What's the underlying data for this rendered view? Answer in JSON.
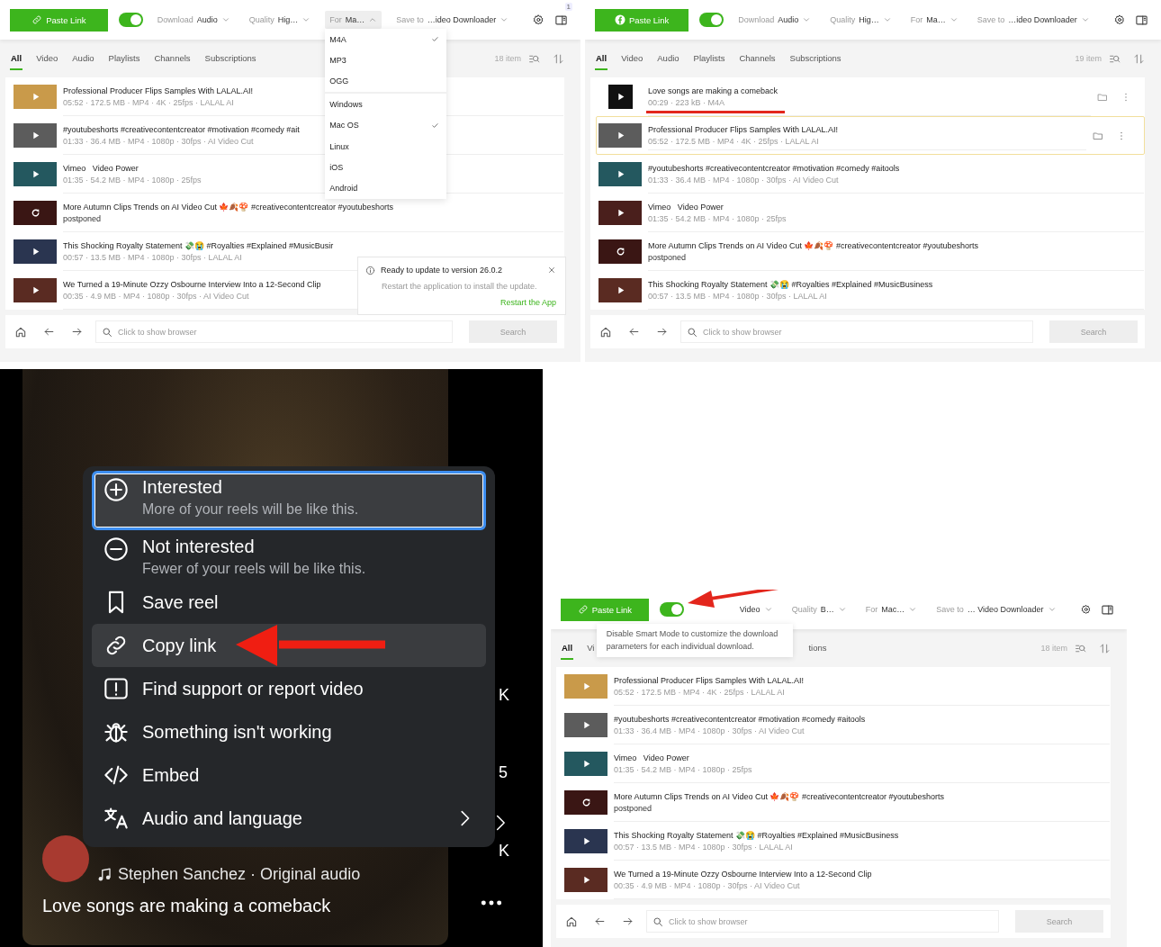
{
  "panels": [
    {
      "kind": "downloader",
      "toolbar": {
        "paste_button": {
          "label": "Paste Link",
          "kind": "link"
        },
        "smart_mode_on": true,
        "badge": "1",
        "selects": [
          {
            "label": "Download",
            "value": "Audio",
            "open": false
          },
          {
            "label": "Quality",
            "value": "Hig…",
            "open": false
          },
          {
            "label": "For",
            "value": "Ma…",
            "open": true
          },
          {
            "label": "Save to",
            "value": "…ideo Downloader",
            "open": false
          }
        ]
      },
      "dropdown": {
        "groups": [
          [
            {
              "label": "M4A",
              "checked": true
            },
            {
              "label": "MP3",
              "checked": false
            },
            {
              "label": "OGG",
              "checked": false
            }
          ],
          [
            {
              "label": "Windows",
              "checked": false
            },
            {
              "label": "Mac OS",
              "checked": true
            },
            {
              "label": "Linux",
              "checked": false
            },
            {
              "label": "iOS",
              "checked": false
            },
            {
              "label": "Android",
              "checked": false
            }
          ]
        ]
      },
      "tabs": [
        {
          "label": "All",
          "selected": true
        },
        {
          "label": "Video",
          "selected": false
        },
        {
          "label": "Audio",
          "selected": false
        },
        {
          "label": "Playlists",
          "selected": false
        },
        {
          "label": "Channels",
          "selected": false
        },
        {
          "label": "Subscriptions",
          "selected": false
        }
      ],
      "item_count": "18 item",
      "rows": [
        {
          "kind": "video",
          "title": "Professional Producer Flips Samples With LALAL.AI!",
          "meta": "05:52 · 172.5 MB · MP4 · 4K · 25fps · LALAL AI"
        },
        {
          "kind": "video",
          "title": "#youtubeshorts #creativecontentcreator #motivation #comedy #ait",
          "meta": "01:33 · 36.4 MB · MP4 · 1080p · 30fps · AI Video Cut"
        },
        {
          "kind": "video",
          "title": "Vimeo   Video Power",
          "meta": "01:35 · 54.2 MB · MP4 · 1080p · 25fps"
        },
        {
          "kind": "reload",
          "title": "More Autumn Clips Trends on AI Video Cut 🍁🍂🍄 #creativecontentcreator #youtubeshorts",
          "status": "postponed"
        },
        {
          "kind": "video",
          "title": "This Shocking Royalty Statement 💸😭 #Royalties #Explained #MusicBusir",
          "meta": "00:57 · 13.5 MB · MP4 · 1080p · 30fps · LALAL AI"
        },
        {
          "kind": "video",
          "title": "We Turned a 19-Minute Ozzy Osbourne Interview Into a 12-Second Clip",
          "meta": "00:35 · 4.9 MB · MP4 · 1080p · 30fps · AI Video Cut"
        }
      ],
      "browser": {
        "placeholder": "Click to show browser",
        "search": "Search"
      },
      "notification": {
        "title": "Ready to update to version 26.0.2",
        "body": "Restart the application to install the update.",
        "action": "Restart the App"
      }
    },
    {
      "kind": "downloader",
      "toolbar": {
        "paste_button": {
          "label": "Paste Link",
          "kind": "facebook"
        },
        "smart_mode_on": true,
        "selects": [
          {
            "label": "Download",
            "value": "Audio",
            "open": false
          },
          {
            "label": "Quality",
            "value": "Hig…",
            "open": false
          },
          {
            "label": "For",
            "value": "Ma…",
            "open": false
          },
          {
            "label": "Save to",
            "value": "…ideo Downloader",
            "open": false
          }
        ]
      },
      "tabs": [
        {
          "label": "All",
          "selected": true
        },
        {
          "label": "Video",
          "selected": false
        },
        {
          "label": "Audio",
          "selected": false
        },
        {
          "label": "Playlists",
          "selected": false
        },
        {
          "label": "Channels",
          "selected": false
        },
        {
          "label": "Subscriptions",
          "selected": false
        }
      ],
      "item_count": "19 item",
      "rows": [
        {
          "kind": "audio",
          "title": "Love songs are making a comeback",
          "meta": "00:29 · 223 kB · M4A",
          "annotation": {
            "kind": "underline"
          },
          "actions_visible": true,
          "selected": false
        },
        {
          "kind": "video",
          "title": "Professional Producer Flips Samples With LALAL.AI!",
          "meta": "05:52 · 172.5 MB · MP4 · 4K · 25fps · LALAL AI",
          "actions_visible": true,
          "selected": true
        },
        {
          "kind": "video",
          "title": "#youtubeshorts #creativecontentcreator #motivation #comedy #aitools",
          "meta": "01:33 · 36.4 MB · MP4 · 1080p · 30fps · AI Video Cut",
          "actions_visible": false,
          "selected": false
        },
        {
          "kind": "video",
          "title": "Vimeo   Video Power",
          "meta": "01:35 · 54.2 MB · MP4 · 1080p · 25fps",
          "actions_visible": false,
          "selected": false
        },
        {
          "kind": "reload",
          "title": "More Autumn Clips Trends on AI Video Cut 🍁🍂🍄 #creativecontentcreator #youtubeshorts",
          "status": "postponed",
          "actions_visible": false,
          "selected": false
        },
        {
          "kind": "video",
          "title": "This Shocking Royalty Statement 💸😭 #Royalties #Explained #MusicBusiness",
          "meta": "00:57 · 13.5 MB · MP4 · 1080p · 30fps · LALAL AI",
          "actions_visible": false,
          "selected": false
        }
      ],
      "browser": {
        "placeholder": "Click to show browser",
        "search": "Search"
      }
    },
    {
      "kind": "reel",
      "menu": [
        {
          "kind": "plus",
          "label": "Interested",
          "sub": "More of your reels will be like this.",
          "focused": true,
          "highlighted": false,
          "has_submenu": false
        },
        {
          "kind": "minus",
          "label": "Not interested",
          "sub": "Fewer of your reels will be like this.",
          "focused": false,
          "highlighted": false,
          "has_submenu": false
        },
        {
          "kind": "bookmark",
          "label": "Save reel",
          "focused": false,
          "highlighted": false,
          "has_submenu": false
        },
        {
          "kind": "link",
          "label": "Copy link",
          "focused": false,
          "highlighted": true,
          "has_submenu": false,
          "annotation": {
            "kind": "arrow"
          }
        },
        {
          "kind": "alert",
          "label": "Find support or report video",
          "focused": false,
          "highlighted": false,
          "has_submenu": false
        },
        {
          "kind": "bug",
          "label": "Something isn't working",
          "focused": false,
          "highlighted": false,
          "has_submenu": false
        },
        {
          "kind": "code",
          "label": "Embed",
          "focused": false,
          "highlighted": false,
          "has_submenu": false
        },
        {
          "kind": "translate",
          "label": "Audio and language",
          "focused": false,
          "highlighted": false,
          "has_submenu": true
        }
      ],
      "side_counts": [
        "K",
        "5",
        "K"
      ],
      "audio": "Stephen Sanchez · Original audio",
      "caption": "Love songs are making a comeback"
    },
    {
      "kind": "downloader",
      "toolbar": {
        "paste_button": {
          "label": "Paste Link",
          "kind": "link"
        },
        "smart_mode_on": true,
        "annotation": {
          "kind": "arrow"
        },
        "tooltip": "Disable Smart Mode to customize the download parameters for each individual download.",
        "selects": [
          {
            "value": "Video",
            "open": false
          },
          {
            "label": "Quality",
            "value": "B…",
            "open": false
          },
          {
            "label": "For",
            "value": "Mac…",
            "open": false
          },
          {
            "label": "Save to",
            "value": "… Video Downloader",
            "open": false
          }
        ]
      },
      "tabs": [
        {
          "label": "All",
          "selected": true
        },
        {
          "label": "Vi",
          "selected": false
        },
        {
          "label": "tions",
          "selected": false,
          "kind": "clipped"
        }
      ],
      "item_count": "18 item",
      "rows": [
        {
          "kind": "video",
          "title": "Professional Producer Flips Samples With LALAL.AI!",
          "meta": "05:52 · 172.5 MB · MP4 · 4K · 25fps · LALAL AI"
        },
        {
          "kind": "video",
          "title": "#youtubeshorts #creativecontentcreator #motivation #comedy #aitools",
          "meta": "01:33 · 36.4 MB · MP4 · 1080p · 30fps · AI Video Cut"
        },
        {
          "kind": "video",
          "title": "Vimeo   Video Power",
          "meta": "01:35 · 54.2 MB · MP4 · 1080p · 25fps"
        },
        {
          "kind": "reload",
          "title": "More Autumn Clips Trends on AI Video Cut 🍁🍂🍄 #creativecontentcreator #youtubeshorts",
          "status": "postponed"
        },
        {
          "kind": "video",
          "title": "This Shocking Royalty Statement 💸😭 #Royalties #Explained #MusicBusiness",
          "meta": "00:57 · 13.5 MB · MP4 · 1080p · 30fps · LALAL AI"
        },
        {
          "kind": "video",
          "title": "We Turned a 19-Minute Ozzy Osbourne Interview Into a 12-Second Clip",
          "meta": "00:35 · 4.9 MB · MP4 · 1080p · 30fps · AI Video Cut"
        }
      ],
      "browser": {
        "placeholder": "Click to show browser",
        "search": "Search"
      }
    }
  ]
}
